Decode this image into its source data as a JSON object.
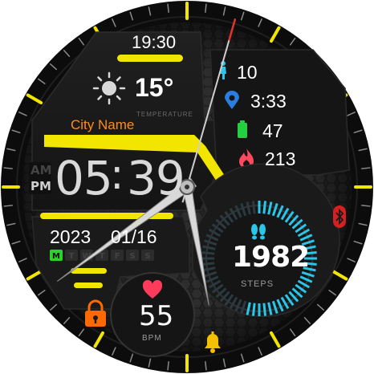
{
  "watch": {
    "bezel_accent": "#f2e600",
    "second_hand_color": "#e0332a",
    "hand_color": "#d9d9d9",
    "time_small": "19:30",
    "weather": {
      "icon": "sun-icon",
      "temperature": "15°",
      "label": "TEMPERATURE"
    },
    "city": "City Name",
    "city_color": "#ff8c1a",
    "stats": {
      "steps_icon": "walking-person-icon",
      "steps_value": "10",
      "location_icon": "map-pin-icon",
      "location_value": "3:33",
      "battery_icon": "battery-icon",
      "battery_value": "47",
      "calories_icon": "flame-icon",
      "calories_value": "213"
    },
    "ampm": {
      "am": "AM",
      "pm": "PM",
      "active": "PM"
    },
    "clock": {
      "hours": "05",
      "separator": ":",
      "minutes": "39"
    },
    "date": {
      "year": "2023",
      "month_day": "01/16"
    },
    "weekdays": [
      "M",
      "T",
      "W",
      "T",
      "F",
      "S",
      "S"
    ],
    "active_weekday_index": 0,
    "steps_ring": {
      "value": "1982",
      "label": "STEPS",
      "icon": "footprints-icon",
      "progress": 0.55,
      "accent": "#29c6ea"
    },
    "heart": {
      "value": "55",
      "label": "BPM",
      "icon": "heart-icon",
      "color": "#ff3b5c"
    },
    "lock_icon": "padlock-icon",
    "bell_icon": "bell-icon",
    "bluetooth_icon": "bluetooth-icon"
  }
}
